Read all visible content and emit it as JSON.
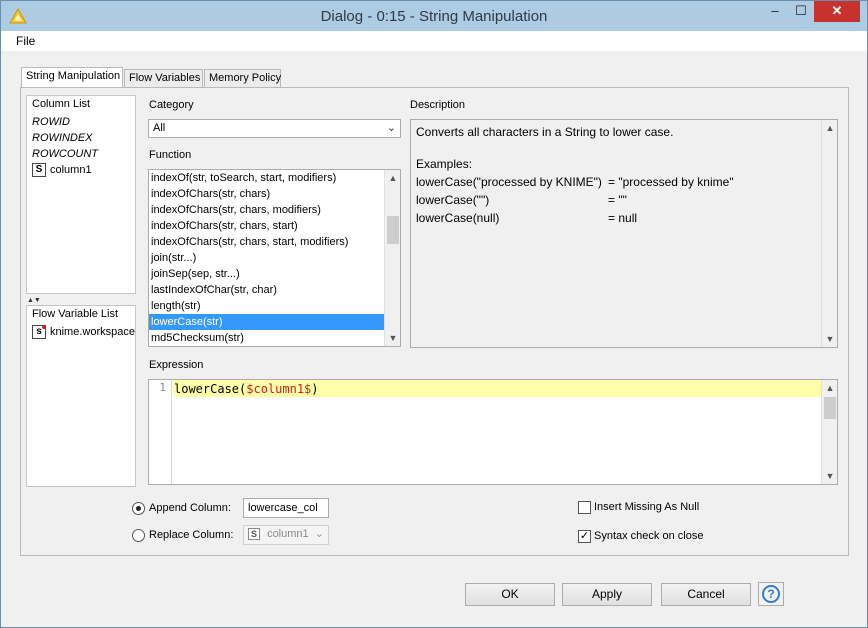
{
  "window": {
    "title": "Dialog - 0:15 - String Manipulation",
    "minimize": "–",
    "maximize": "☐",
    "close": "✕"
  },
  "menu": {
    "file": "File"
  },
  "tabs": [
    "String Manipulation",
    "Flow Variables",
    "Memory Policy"
  ],
  "column_list": {
    "header": "Column List",
    "items": [
      "ROWID",
      "ROWINDEX",
      "ROWCOUNT"
    ],
    "column": {
      "icon": "S",
      "label": "column1"
    }
  },
  "flow_variable_list": {
    "header": "Flow Variable List",
    "item": {
      "icon": "s",
      "label": "knime.workspace"
    }
  },
  "category": {
    "label": "Category",
    "value": "All"
  },
  "function": {
    "label": "Function",
    "items": [
      "indexOf(str, toSearch, start, modifiers)",
      "indexOfChars(str, chars)",
      "indexOfChars(str, chars, modifiers)",
      "indexOfChars(str, chars, start)",
      "indexOfChars(str, chars, start, modifiers)",
      "join(str...)",
      "joinSep(sep, str...)",
      "lastIndexOfChar(str, char)",
      "length(str)",
      "lowerCase(str)",
      "md5Checksum(str)"
    ],
    "selected": "lowerCase(str)"
  },
  "description": {
    "label": "Description",
    "summary": "Converts all characters in a String to lower case.",
    "examples_label": "Examples:",
    "examples": [
      {
        "expr": "lowerCase(\"processed by KNIME\")",
        "result": "= \"processed by knime\""
      },
      {
        "expr": "lowerCase(\"\")",
        "result": "= \"\""
      },
      {
        "expr": "lowerCase(null)",
        "result": "= null"
      }
    ]
  },
  "expression": {
    "label": "Expression",
    "line_number": "1",
    "prefix": "lowerCase(",
    "column_ref": "$column1$",
    "suffix": ")"
  },
  "output": {
    "append_label": "Append Column:",
    "append_value": "lowercase_col",
    "append_selected": true,
    "replace_label": "Replace Column:",
    "replace_icon": "S",
    "replace_value": "column1",
    "insert_missing_label": "Insert Missing As Null",
    "insert_missing_checked": false,
    "syntax_check_label": "Syntax check on close",
    "syntax_check_checked": true
  },
  "buttons": {
    "ok": "OK",
    "apply": "Apply",
    "cancel": "Cancel",
    "help": "?"
  },
  "colors": {
    "selection": "#3399ff",
    "expression_highlight": "#ffffaa",
    "close_button": "#c7322e"
  }
}
